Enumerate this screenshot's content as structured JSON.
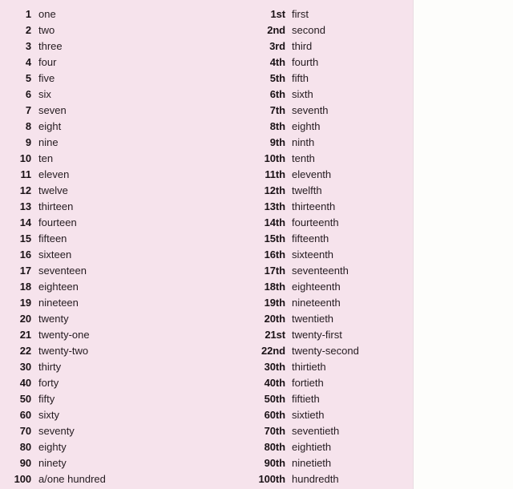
{
  "page": {
    "title": "Cardinal and ordinal numbers",
    "background_color": "#f6e3ec",
    "panel_color": "#f6e3ec",
    "outside_color": "#fdfdfb",
    "text_color": "#241b20",
    "number_color": "#1a1216"
  },
  "columns": {
    "cardinal_header": "",
    "ordinal_header": ""
  },
  "rows": [
    {
      "cardinal_number": "1",
      "cardinal_word": "one",
      "ordinal_number": "1st",
      "ordinal_word": "first"
    },
    {
      "cardinal_number": "2",
      "cardinal_word": "two",
      "ordinal_number": "2nd",
      "ordinal_word": "second"
    },
    {
      "cardinal_number": "3",
      "cardinal_word": "three",
      "ordinal_number": "3rd",
      "ordinal_word": "third"
    },
    {
      "cardinal_number": "4",
      "cardinal_word": "four",
      "ordinal_number": "4th",
      "ordinal_word": "fourth"
    },
    {
      "cardinal_number": "5",
      "cardinal_word": "five",
      "ordinal_number": "5th",
      "ordinal_word": "fifth"
    },
    {
      "cardinal_number": "6",
      "cardinal_word": "six",
      "ordinal_number": "6th",
      "ordinal_word": "sixth"
    },
    {
      "cardinal_number": "7",
      "cardinal_word": "seven",
      "ordinal_number": "7th",
      "ordinal_word": "seventh"
    },
    {
      "cardinal_number": "8",
      "cardinal_word": "eight",
      "ordinal_number": "8th",
      "ordinal_word": "eighth"
    },
    {
      "cardinal_number": "9",
      "cardinal_word": "nine",
      "ordinal_number": "9th",
      "ordinal_word": "ninth"
    },
    {
      "cardinal_number": "10",
      "cardinal_word": "ten",
      "ordinal_number": "10th",
      "ordinal_word": "tenth"
    },
    {
      "cardinal_number": "11",
      "cardinal_word": "eleven",
      "ordinal_number": "11th",
      "ordinal_word": "eleventh"
    },
    {
      "cardinal_number": "12",
      "cardinal_word": "twelve",
      "ordinal_number": "12th",
      "ordinal_word": "twelfth"
    },
    {
      "cardinal_number": "13",
      "cardinal_word": "thirteen",
      "ordinal_number": "13th",
      "ordinal_word": "thirteenth"
    },
    {
      "cardinal_number": "14",
      "cardinal_word": "fourteen",
      "ordinal_number": "14th",
      "ordinal_word": "fourteenth"
    },
    {
      "cardinal_number": "15",
      "cardinal_word": "fifteen",
      "ordinal_number": "15th",
      "ordinal_word": "fifteenth"
    },
    {
      "cardinal_number": "16",
      "cardinal_word": "sixteen",
      "ordinal_number": "16th",
      "ordinal_word": "sixteenth"
    },
    {
      "cardinal_number": "17",
      "cardinal_word": "seventeen",
      "ordinal_number": "17th",
      "ordinal_word": "seventeenth"
    },
    {
      "cardinal_number": "18",
      "cardinal_word": "eighteen",
      "ordinal_number": "18th",
      "ordinal_word": "eighteenth"
    },
    {
      "cardinal_number": "19",
      "cardinal_word": "nineteen",
      "ordinal_number": "19th",
      "ordinal_word": "nineteenth"
    },
    {
      "cardinal_number": "20",
      "cardinal_word": "twenty",
      "ordinal_number": "20th",
      "ordinal_word": "twentieth"
    },
    {
      "cardinal_number": "21",
      "cardinal_word": "twenty-one",
      "ordinal_number": "21st",
      "ordinal_word": "twenty-first"
    },
    {
      "cardinal_number": "22",
      "cardinal_word": "twenty-two",
      "ordinal_number": "22nd",
      "ordinal_word": "twenty-second"
    },
    {
      "cardinal_number": "30",
      "cardinal_word": "thirty",
      "ordinal_number": "30th",
      "ordinal_word": "thirtieth"
    },
    {
      "cardinal_number": "40",
      "cardinal_word": "forty",
      "ordinal_number": "40th",
      "ordinal_word": "fortieth"
    },
    {
      "cardinal_number": "50",
      "cardinal_word": "fifty",
      "ordinal_number": "50th",
      "ordinal_word": "fiftieth"
    },
    {
      "cardinal_number": "60",
      "cardinal_word": "sixty",
      "ordinal_number": "60th",
      "ordinal_word": "sixtieth"
    },
    {
      "cardinal_number": "70",
      "cardinal_word": "seventy",
      "ordinal_number": "70th",
      "ordinal_word": "seventieth"
    },
    {
      "cardinal_number": "80",
      "cardinal_word": "eighty",
      "ordinal_number": "80th",
      "ordinal_word": "eightieth"
    },
    {
      "cardinal_number": "90",
      "cardinal_word": "ninety",
      "ordinal_number": "90th",
      "ordinal_word": "ninetieth"
    },
    {
      "cardinal_number": "100",
      "cardinal_word": "a/one hundred",
      "ordinal_number": "100th",
      "ordinal_word": "hundredth"
    }
  ]
}
